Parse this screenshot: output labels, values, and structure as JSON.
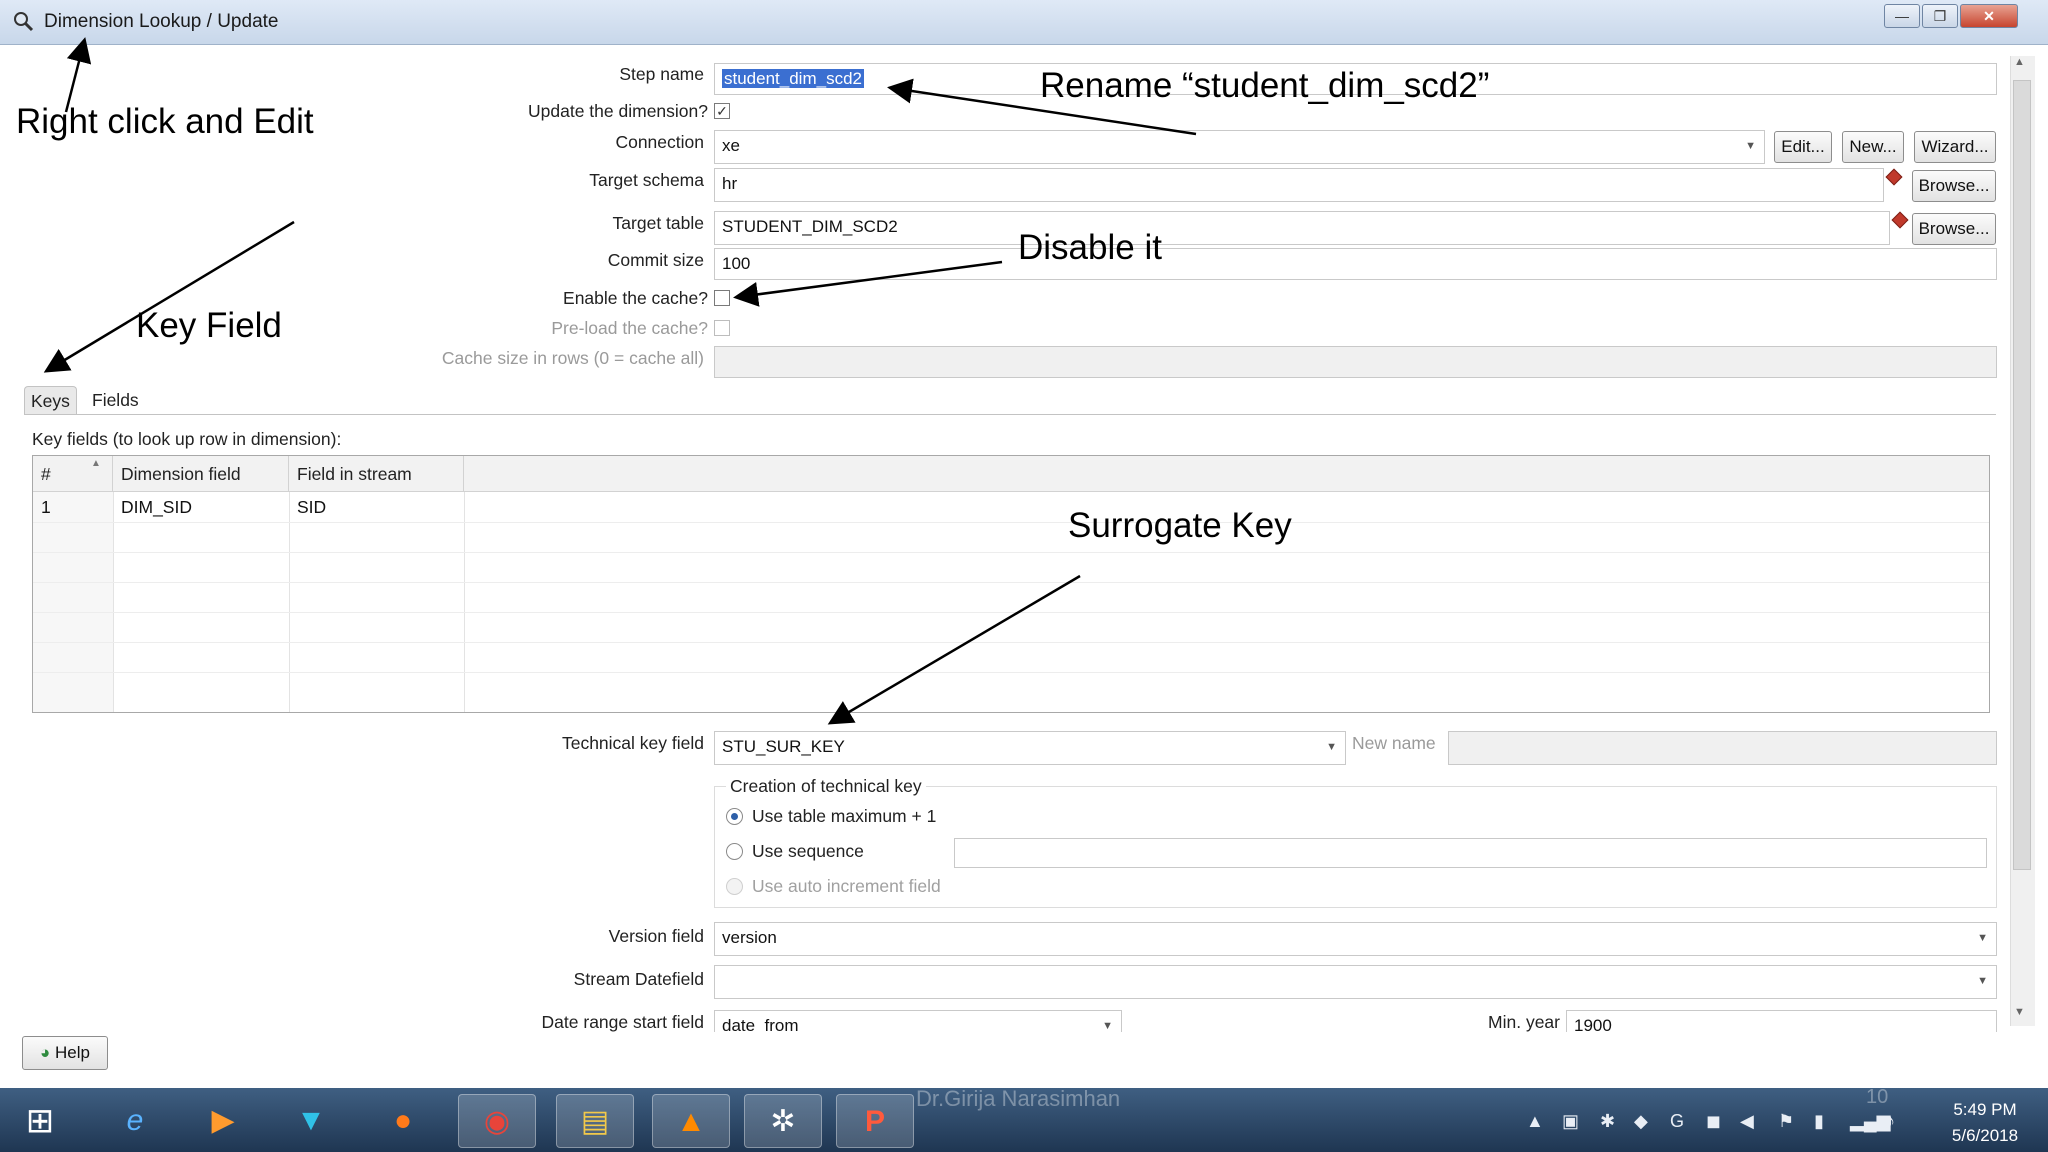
{
  "window": {
    "title": "Dimension Lookup / Update",
    "controls": [
      "—",
      "❐",
      "✕"
    ]
  },
  "form": {
    "step_name_label": "Step name",
    "step_name_value": "student_dim_scd2",
    "update_dimension_label": "Update the dimension?",
    "update_dimension_checked": true,
    "connection_label": "Connection",
    "connection_value": "xe",
    "edit_label": "Edit...",
    "new_label": "New...",
    "wizard_label": "Wizard...",
    "target_schema_label": "Target schema",
    "target_schema_value": "hr",
    "browse_label": "Browse...",
    "target_table_label": "Target table",
    "target_table_value": "STUDENT_DIM_SCD2",
    "commit_size_label": "Commit size",
    "commit_size_value": "100",
    "enable_cache_label": "Enable the cache?",
    "enable_cache_checked": false,
    "preload_cache_label": "Pre-load the cache?",
    "cache_size_label": "Cache size in rows (0 = cache all)"
  },
  "tabs": {
    "keys": "Keys",
    "fields": "Fields"
  },
  "keys_table": {
    "caption": "Key fields (to look up row in dimension):",
    "columns": [
      "#",
      "Dimension field",
      "Field in stream"
    ],
    "rows": [
      {
        "num": "1",
        "dimension_field": "DIM_SID",
        "field_in_stream": "SID"
      }
    ]
  },
  "technical": {
    "tech_key_label": "Technical key field",
    "tech_key_value": "STU_SUR_KEY",
    "new_name_label": "New name",
    "group_label": "Creation of technical key",
    "option_table_max": "Use table maximum + 1",
    "option_sequence": "Use sequence",
    "option_auto_increment": "Use auto increment field",
    "selected_option": "table_max"
  },
  "versioning": {
    "version_label": "Version field",
    "version_value": "version",
    "stream_datefield_label": "Stream Datefield",
    "date_range_start_label": "Date range start field",
    "date_range_start_value": "date_from",
    "min_year_label": "Min. year",
    "min_year_value": "1900"
  },
  "help_label": "Help",
  "annotations": {
    "right_click": "Right click and Edit",
    "rename": "Rename “student_dim_scd2”",
    "disable": "Disable it",
    "key_field": "Key Field",
    "surrogate": "Surrogate Key"
  },
  "taskbar": {
    "watermark": "Dr.Girija Narasimhan",
    "page_number": "10",
    "time": "5:49 PM",
    "date": "5/6/2018",
    "apps": [
      "windows-start-icon",
      "internet-explorer-icon",
      "media-player-icon",
      "tool-icon",
      "firefox-icon",
      "chrome-icon",
      "file-explorer-icon",
      "vlc-icon",
      "pentaho-spoon-icon",
      "powerpoint-icon"
    ]
  }
}
